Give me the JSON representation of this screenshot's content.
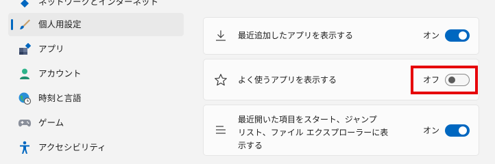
{
  "sidebar": {
    "items": [
      {
        "label": "ネットワークとインターネット",
        "icon": "network-icon"
      },
      {
        "label": "個人用設定",
        "icon": "brush-icon",
        "selected": true
      },
      {
        "label": "アプリ",
        "icon": "apps-icon"
      },
      {
        "label": "アカウント",
        "icon": "account-icon"
      },
      {
        "label": "時刻と言語",
        "icon": "time-language-icon"
      },
      {
        "label": "ゲーム",
        "icon": "gamepad-icon"
      },
      {
        "label": "アクセシビリティ",
        "icon": "accessibility-icon"
      }
    ]
  },
  "settings": {
    "rows": [
      {
        "label": "最近追加したアプリを表示する",
        "state": "オン",
        "on": true,
        "icon": "download-icon"
      },
      {
        "label": "よく使うアプリを表示する",
        "state": "オフ",
        "on": false,
        "icon": "star-icon"
      },
      {
        "label_lines": [
          "最近開いた項目をスタート、ジャンプ",
          "リスト、ファイル エクスプローラーに表",
          "示する"
        ],
        "state": "オン",
        "on": true,
        "icon": "list-icon"
      }
    ]
  },
  "colors": {
    "accent": "#0067c0",
    "highlight": "#e6000a",
    "background": "#f3f3f3",
    "card": "#fbfbfb"
  }
}
